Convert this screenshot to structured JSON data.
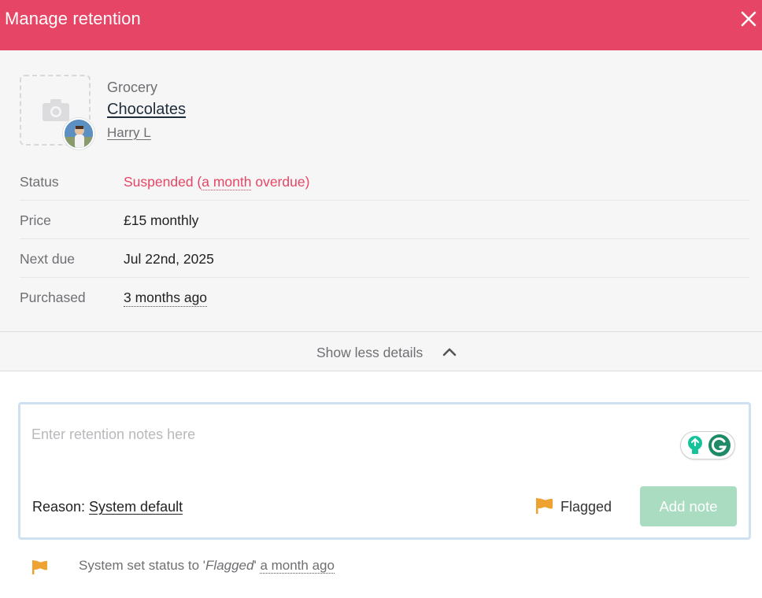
{
  "header": {
    "title": "Manage retention",
    "close_icon": "close-icon",
    "color": "#e64565"
  },
  "product": {
    "category": "Grocery",
    "name": "Chocolates",
    "owner": "Harry L",
    "image_icon": "camera-icon"
  },
  "details": [
    {
      "label": "Status",
      "value_prefix": "Suspended (",
      "value_highlight": "a month",
      "value_suffix": " overdue)",
      "color": "#e64565"
    },
    {
      "label": "Price",
      "value": "£15 monthly"
    },
    {
      "label": "Next due",
      "value": "Jul 22nd, 2025"
    },
    {
      "label": "Purchased",
      "value": "3 months ago"
    }
  ],
  "toggle": {
    "label": "Show less details",
    "icon": "chevron-up-icon"
  },
  "notes": {
    "placeholder": "Enter retention notes here",
    "reason_label": "Reason: ",
    "reason_value": "System default",
    "flag_label": "Flagged",
    "flag_color": "#eea232",
    "add_button": "Add note",
    "add_button_color": "#a9dcc1"
  },
  "activity": {
    "prefix": "System set status to '",
    "status": "Flagged",
    "suffix": "' ",
    "time": "a month ago",
    "icon": "flag-icon"
  }
}
